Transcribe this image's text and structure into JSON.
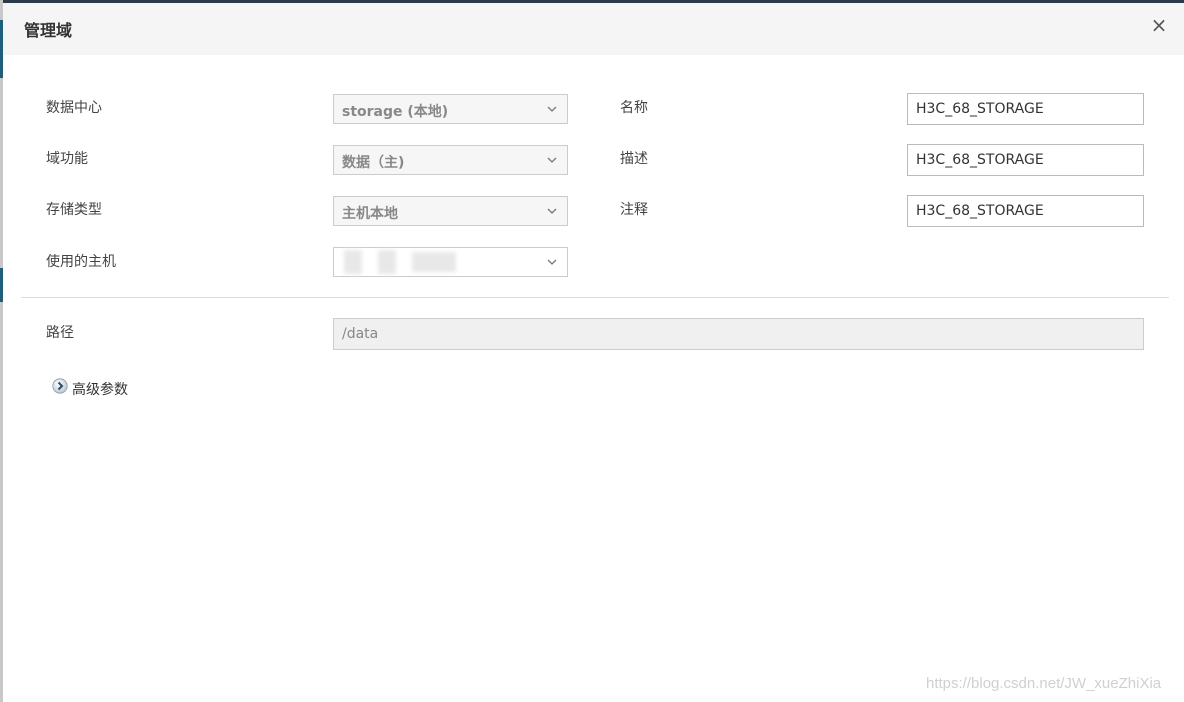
{
  "dialog": {
    "title": "管理域",
    "close_label": "×"
  },
  "form": {
    "datacenter": {
      "label": "数据中心",
      "value": "storage (本地)"
    },
    "domain_function": {
      "label": "域功能",
      "value": "数据（主)"
    },
    "storage_type": {
      "label": "存储类型",
      "value": "主机本地"
    },
    "host": {
      "label": "使用的主机",
      "value": ""
    },
    "name": {
      "label": "名称",
      "value": "H3C_68_STORAGE"
    },
    "description": {
      "label": "描述",
      "value": "H3C_68_STORAGE"
    },
    "comment": {
      "label": "注释",
      "value": "H3C_68_STORAGE"
    },
    "path": {
      "label": "路径",
      "value": "/data"
    }
  },
  "advanced": {
    "label": "高级参数",
    "icon": "chevron-right-circle-icon"
  },
  "watermark": "https://blog.csdn.net/JW_xueZhiXia",
  "colors": {
    "header_bg": "#f5f5f5",
    "accent": "#1f5f7a"
  }
}
